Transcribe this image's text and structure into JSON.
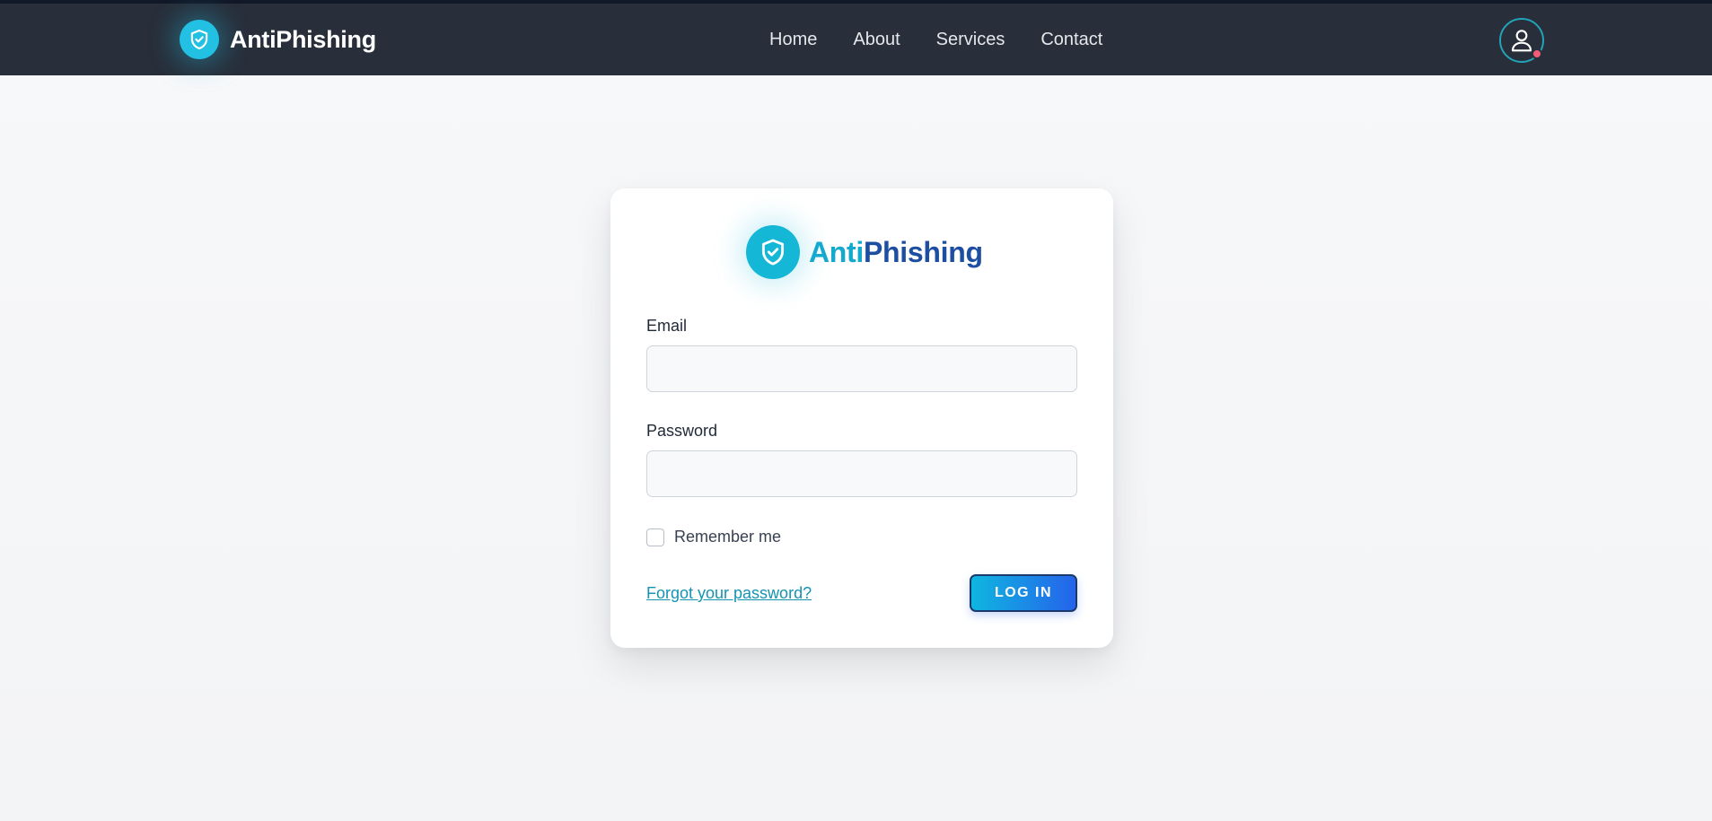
{
  "nav": {
    "brand": "AntiPhishing",
    "links": [
      "Home",
      "About",
      "Services",
      "Contact"
    ],
    "account_icon": "user-icon"
  },
  "login": {
    "brand_part1": "Anti",
    "brand_part2": "Phishing",
    "email_label": "Email",
    "email_value": "",
    "password_label": "Password",
    "password_value": "",
    "remember_label": "Remember me",
    "remember_checked": false,
    "forgot_link": "Forgot your password?",
    "submit_label": "LOG IN"
  },
  "colors": {
    "navbar": "#282e3a",
    "accent": "#22c1e3",
    "brand_dark": "#1e4ea1",
    "notification_dot": "#f05d78"
  }
}
